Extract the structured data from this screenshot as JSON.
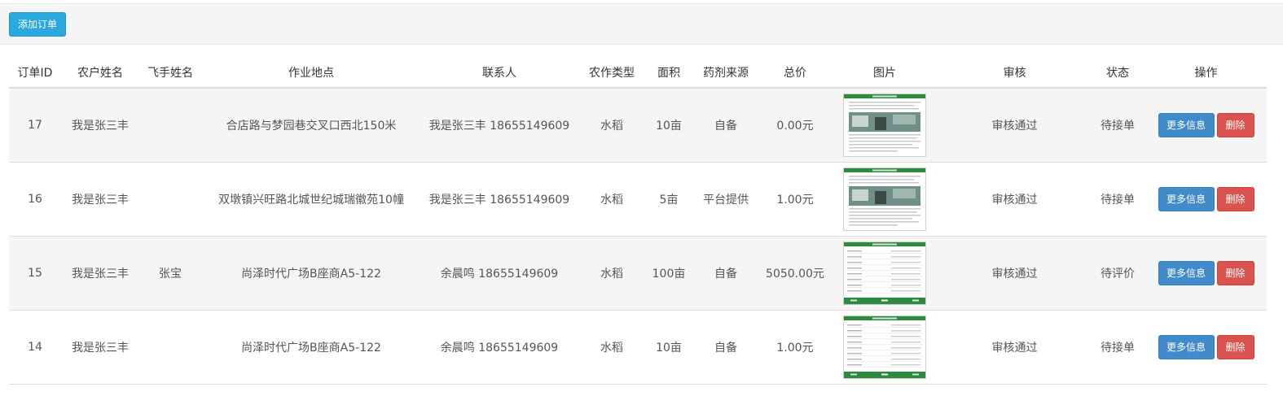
{
  "toolbar": {
    "add_label": "添加订单"
  },
  "table": {
    "headers": [
      "订单ID",
      "农户姓名",
      "飞手姓名",
      "作业地点",
      "联系人",
      "农作类型",
      "面积",
      "药剂来源",
      "总价",
      "图片",
      "审核",
      "状态",
      "操作"
    ],
    "rows": [
      {
        "id": "17",
        "farmer": "我是张三丰",
        "pilot": "",
        "location": "合店路与梦园巷交叉口西北150米",
        "contact": "我是张三丰 18655149609",
        "crop": "水稻",
        "area": "10亩",
        "source": "自备",
        "price": "0.00元",
        "image": "photo-thumbnail",
        "review": "审核通过",
        "status": "待接单",
        "status_tone": "ok"
      },
      {
        "id": "16",
        "farmer": "我是张三丰",
        "pilot": "",
        "location": "双墩镇兴旺路北城世纪城瑞徽苑10幢",
        "contact": "我是张三丰 18655149609",
        "crop": "水稻",
        "area": "5亩",
        "source": "平台提供",
        "price": "1.00元",
        "image": "photo-thumbnail",
        "review": "审核通过",
        "status": "待接单",
        "status_tone": "ok"
      },
      {
        "id": "15",
        "farmer": "我是张三丰",
        "pilot": "张宝",
        "location": "尚泽时代广场B座商A5-122",
        "contact": "余晨鸣 18655149609",
        "crop": "水稻",
        "area": "100亩",
        "source": "自备",
        "price": "5050.00元",
        "image": "form-thumbnail",
        "review": "审核通过",
        "status": "待评价",
        "status_tone": "warn"
      },
      {
        "id": "14",
        "farmer": "我是张三丰",
        "pilot": "",
        "location": "尚泽时代广场B座商A5-122",
        "contact": "余晨鸣 18655149609",
        "crop": "水稻",
        "area": "10亩",
        "source": "自备",
        "price": "1.00元",
        "image": "form-thumbnail",
        "review": "审核通过",
        "status": "待接单",
        "status_tone": "ok"
      }
    ],
    "more_label": "更多信息",
    "delete_label": "删除"
  },
  "colors": {
    "success": "#5cb85c",
    "warning": "#f0ad4e",
    "primary": "#428bca",
    "danger": "#d9534f",
    "info": "#29a9e0"
  }
}
